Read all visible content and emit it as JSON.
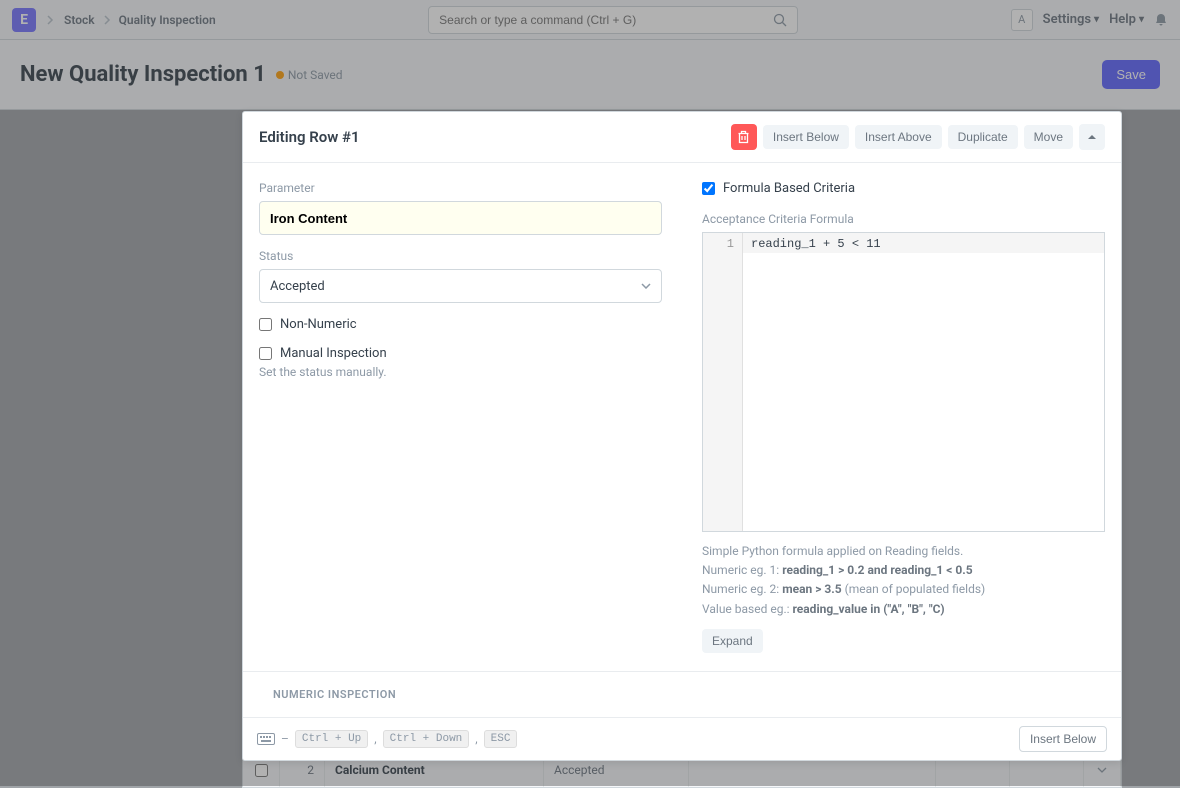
{
  "navbar": {
    "logo_letter": "E",
    "breadcrumb": [
      "Stock",
      "Quality Inspection"
    ],
    "search_placeholder": "Search or type a command (Ctrl + G)",
    "avatar_letter": "A",
    "settings_label": "Settings",
    "help_label": "Help"
  },
  "page": {
    "title": "New Quality Inspection 1",
    "status_label": "Not Saved",
    "save_label": "Save"
  },
  "modal": {
    "title": "Editing Row #1",
    "actions": {
      "insert_below": "Insert Below",
      "insert_above": "Insert Above",
      "duplicate": "Duplicate",
      "move": "Move"
    },
    "left": {
      "parameter_label": "Parameter",
      "parameter_value": "Iron Content",
      "status_label": "Status",
      "status_value": "Accepted",
      "non_numeric_label": "Non-Numeric",
      "manual_label": "Manual Inspection",
      "manual_help": "Set the status manually."
    },
    "right": {
      "formula_checkbox_label": "Formula Based Criteria",
      "formula_label": "Acceptance Criteria Formula",
      "formula_line_no": "1",
      "formula_code": "reading_1 + 5 < 11",
      "help_line1": "Simple Python formula applied on Reading fields.",
      "help_num1_prefix": "Numeric eg. 1: ",
      "help_num1_bold": "reading_1 > 0.2 and reading_1 < 0.5",
      "help_num2_prefix": "Numeric eg. 2: ",
      "help_num2_bold": "mean > 3.5",
      "help_num2_suffix": " (mean of populated fields)",
      "help_val_prefix": "Value based eg.: ",
      "help_val_bold": "reading_value in (\"A\", \"B\", \"C)",
      "expand_label": "Expand"
    },
    "section_numeric": "NUMERIC INSPECTION",
    "footer": {
      "kbd1": "Ctrl + Up",
      "kbd2": "Ctrl + Down",
      "kbd3": "ESC",
      "insert_below": "Insert Below"
    }
  },
  "table_row": {
    "index": "2",
    "parameter": "Calcium Content",
    "status": "Accepted"
  }
}
